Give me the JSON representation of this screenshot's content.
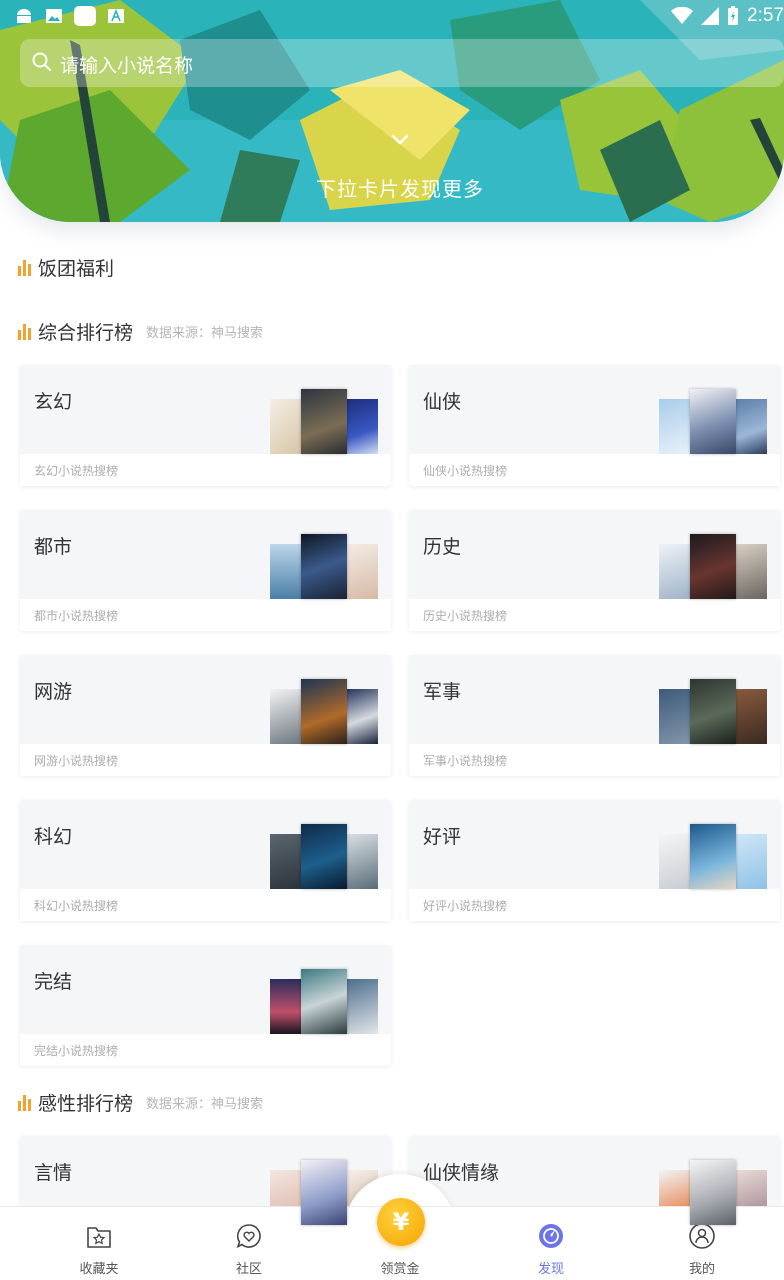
{
  "status_bar": {
    "time": "2:57"
  },
  "search": {
    "placeholder": "请输入小说名称"
  },
  "banner": {
    "pull_hint": "下拉卡片发现更多"
  },
  "sections": {
    "welfare": {
      "title": "饭团福利"
    },
    "comprehensive": {
      "title": "综合排行榜",
      "source": "数据来源：神马搜索",
      "cards": [
        {
          "title": "玄幻",
          "subtitle": "玄幻小说热搜榜"
        },
        {
          "title": "仙侠",
          "subtitle": "仙侠小说热搜榜"
        },
        {
          "title": "都市",
          "subtitle": "都市小说热搜榜"
        },
        {
          "title": "历史",
          "subtitle": "历史小说热搜榜"
        },
        {
          "title": "网游",
          "subtitle": "网游小说热搜榜"
        },
        {
          "title": "军事",
          "subtitle": "军事小说热搜榜"
        },
        {
          "title": "科幻",
          "subtitle": "科幻小说热搜榜"
        },
        {
          "title": "好评",
          "subtitle": "好评小说热搜榜"
        },
        {
          "title": "完结",
          "subtitle": "完结小说热搜榜"
        }
      ]
    },
    "emotional": {
      "title": "感性排行榜",
      "source": "数据来源：神马搜索",
      "cards": [
        {
          "title": "言情"
        },
        {
          "title": "仙侠情缘"
        }
      ]
    }
  },
  "bottom_nav": {
    "items": [
      {
        "label": "收藏夹",
        "icon": "bookmark-folder-icon",
        "active": false
      },
      {
        "label": "社区",
        "icon": "heart-chat-icon",
        "active": false
      },
      {
        "label": "领赏金",
        "icon": "yuan-coin-icon",
        "active": false
      },
      {
        "label": "发现",
        "icon": "compass-icon",
        "active": true
      },
      {
        "label": "我的",
        "icon": "user-icon",
        "active": false
      }
    ],
    "coin_symbol": "¥"
  },
  "colors": {
    "accent": "#6b74e8",
    "bars": "#f3a12f",
    "coin": "#f5a300",
    "banner": "#2bb3b7"
  }
}
